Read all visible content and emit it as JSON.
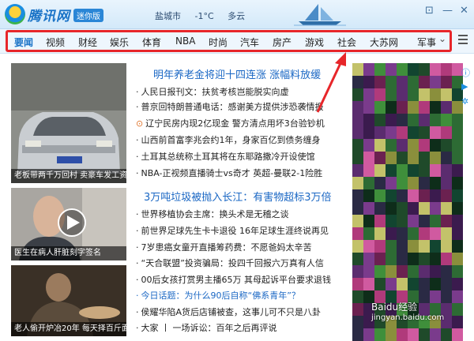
{
  "app": {
    "logo_text": "腾讯网",
    "badge": "迷你版",
    "weather": {
      "city": "盐城市",
      "temp": "-1°C",
      "cond": "多云"
    },
    "controls": [
      "⊡",
      "—",
      "✕"
    ]
  },
  "nav": {
    "items": [
      "要闻",
      "视频",
      "财经",
      "娱乐",
      "体育",
      "NBA",
      "时尚",
      "汽车",
      "房产",
      "游戏",
      "社会",
      "大苏网",
      "军事"
    ],
    "active_index": 0
  },
  "thumbs": [
    {
      "caption": "老板带两千万回村 卖豪车发工资"
    },
    {
      "caption": "医生在病人肝脏刻字签名"
    },
    {
      "caption": "老人偷开炉冶20年 每天择百斤面"
    }
  ],
  "sections": [
    {
      "headline": "明年养老金将迎十四连涨 涨幅料放缓",
      "items": [
        "人民日报刊文：扶贫考核岂能脱实向虚",
        "普京回特朗普通电话：感谢美方提供涉恐袭情报",
        "辽宁民房内现2亿现金  警方清点用坏3台验钞机",
        "山西前首富李兆会约1年，身家百亿到债务缠身",
        "土耳其总统称土耳其将在东耶路撒冷开设使馆",
        "NBA-正视频直播骑士vs奇才 英超-曼联2-1险胜"
      ]
    },
    {
      "headline": "3万吨垃圾被抛入长江：有害物超标3万倍",
      "items": [
        "世界移植协会主席：换头术是无稽之谈",
        "前世界足球先生卡卡退役 16年足球生涯终说再见",
        "7岁患癌女童开直播筹药费：不愿爸妈太辛苦",
        "“天合联盟”投资骗局：投四千回报六万真有人信",
        "00后女孩打赏男主播65万 其母起诉平台要求退钱",
        "今日话题：为什么90后自称“佛系青年”？",
        "侯耀华陷A货后店铺被查，这事儿可不只是八卦",
        "大家 丨 一场诉讼：百年之后再评说"
      ]
    }
  ],
  "watermark": {
    "line1": "Baidu经验",
    "line2": "jingyan.baidu.com"
  },
  "colors": {
    "accent": "#1a73c7",
    "annotation_red": "#e7262a",
    "headline_blue": "#1a67c4"
  },
  "icons": [
    "logo-icon",
    "boat-icon",
    "restore-icon",
    "minimize-icon",
    "close-icon",
    "menu-icon",
    "chevron-down-icon",
    "clock-icon"
  ]
}
